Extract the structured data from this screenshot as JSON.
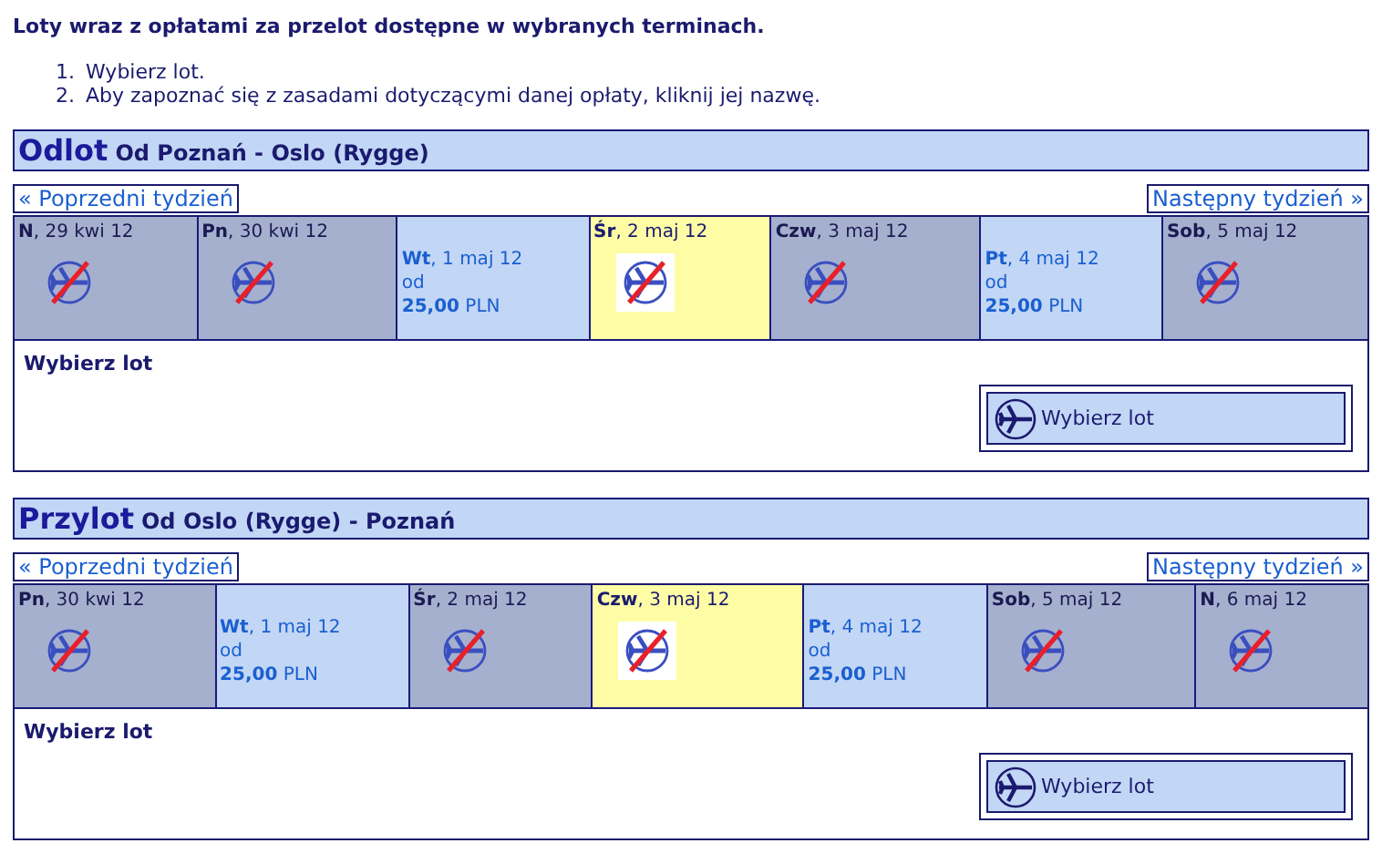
{
  "intro": "Loty wraz z opłatami za przelot dostępne w wybranych terminach.",
  "steps": [
    {
      "marker": "1.",
      "text": "Wybierz lot."
    },
    {
      "marker": "2.",
      "text": "Aby zapoznać się z zasadami dotyczącymi danej opłaty, kliknij jej nazwę."
    }
  ],
  "sections": [
    {
      "title": "Odlot",
      "route": "Od Poznań - Oslo (Rygge)",
      "prev": "« Poprzedni tydzień",
      "next": "Następny tydzień »",
      "days": [
        {
          "kind": "none",
          "label": "**N**, 29 kwi 12",
          "selected": false
        },
        {
          "kind": "none",
          "label": "**Pn**, 30 kwi 12",
          "selected": false
        },
        {
          "kind": "fare",
          "label": "**Wt**, 1 maj 12",
          "from": "od",
          "price": "**25,00** PLN",
          "selected": false
        },
        {
          "kind": "none",
          "label": "**Śr**, 2 maj 12",
          "selected": true
        },
        {
          "kind": "none",
          "label": "**Czw**, 3 maj 12",
          "selected": false
        },
        {
          "kind": "fare",
          "label": "**Pt**, 4 maj 12",
          "from": "od",
          "price": "**25,00** PLN",
          "selected": false
        },
        {
          "kind": "none",
          "label": "**Sob**, 5 maj 12",
          "selected": false
        }
      ],
      "panel_title": "Wybierz lot",
      "button": "Wybierz lot"
    },
    {
      "title": "Przylot",
      "route": "Od Oslo (Rygge) - Poznań",
      "prev": "« Poprzedni tydzień",
      "next": "Następny tydzień »",
      "days": [
        {
          "kind": "none",
          "label": "**Pn**, 30 kwi 12",
          "selected": false
        },
        {
          "kind": "fare",
          "label": "**Wt**, 1 maj 12",
          "from": "od",
          "price": "**25,00** PLN",
          "selected": false
        },
        {
          "kind": "none",
          "label": "**Śr**, 2 maj 12",
          "selected": false
        },
        {
          "kind": "none",
          "label": "**Czw**, 3 maj 12",
          "selected": true
        },
        {
          "kind": "fare",
          "label": "**Pt**, 4 maj 12",
          "from": "od",
          "price": "**25,00** PLN",
          "selected": false
        },
        {
          "kind": "none",
          "label": "**Sob**, 5 maj 12",
          "selected": false
        },
        {
          "kind": "none",
          "label": "**N**, 6 maj 12",
          "selected": false
        }
      ],
      "panel_title": "Wybierz lot",
      "button": "Wybierz lot"
    }
  ]
}
